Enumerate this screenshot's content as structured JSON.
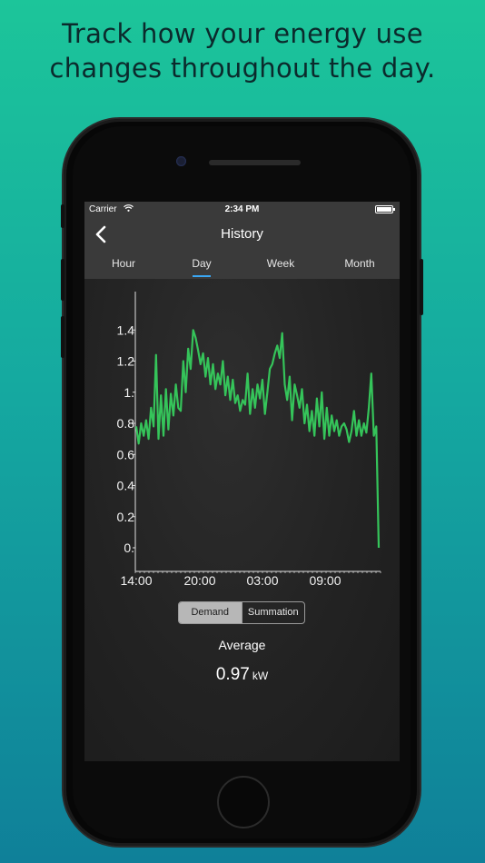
{
  "headline": {
    "line1": "Track how your energy use",
    "line2": "changes throughout the day."
  },
  "statusbar": {
    "carrier": "Carrier",
    "time": "2:34 PM",
    "wifi_icon": "wifi-icon",
    "battery_icon": "battery-icon"
  },
  "navbar": {
    "back_icon": "chevron-left-icon",
    "title": "History",
    "tabs": [
      {
        "label": "Hour",
        "active": false
      },
      {
        "label": "Day",
        "active": true
      },
      {
        "label": "Week",
        "active": false
      },
      {
        "label": "Month",
        "active": false
      }
    ]
  },
  "chart_data": {
    "type": "line",
    "y_ticks": [
      "0.",
      "0.2",
      "0.4",
      "0.6",
      "0.8",
      "1.",
      "1.2",
      "1.4"
    ],
    "x_ticks": [
      "14:00",
      "20:00",
      "03:00",
      "09:00"
    ],
    "ylim": [
      0,
      1.6
    ],
    "series": [
      {
        "color": "#35c45a",
        "values": [
          0.78,
          0.67,
          0.8,
          0.72,
          0.82,
          0.7,
          0.9,
          0.78,
          1.24,
          0.7,
          0.98,
          0.72,
          1.02,
          0.76,
          0.99,
          0.85,
          1.05,
          0.9,
          0.88,
          1.2,
          1.0,
          1.28,
          1.15,
          1.4,
          1.35,
          1.27,
          1.18,
          1.25,
          1.1,
          1.22,
          1.05,
          1.18,
          1.02,
          1.12,
          1.05,
          1.2,
          0.98,
          1.1,
          0.95,
          1.08,
          0.93,
          0.98,
          0.88,
          0.95,
          0.92,
          1.12,
          0.86,
          1.02,
          0.9,
          1.05,
          0.96,
          1.08,
          0.86,
          1.0,
          1.15,
          1.18,
          1.25,
          1.3,
          1.22,
          1.38,
          1.05,
          0.95,
          1.1,
          0.82,
          1.05,
          0.98,
          0.9,
          1.02,
          0.8,
          0.92,
          0.75,
          0.88,
          0.72,
          0.96,
          0.78,
          1.0,
          0.7,
          0.9,
          0.72,
          0.85,
          0.75,
          0.82,
          0.72,
          0.78,
          0.8,
          0.76,
          0.68,
          0.75,
          0.88,
          0.72,
          0.82,
          0.72,
          0.8,
          0.74,
          0.9,
          1.12,
          0.72,
          0.78,
          0.0
        ]
      }
    ]
  },
  "segment": {
    "left": "Demand",
    "right": "Summation"
  },
  "average": {
    "label": "Average",
    "value": "0.97",
    "unit": "kW"
  }
}
